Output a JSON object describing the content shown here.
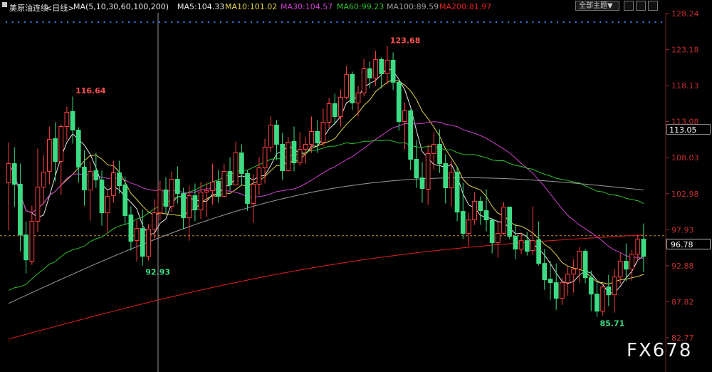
{
  "header": {
    "symbol": "美原油连续",
    "period": "<日线>",
    "ma_params": "MA(5,10,30,60,100,200)",
    "ma5": "MA5:104.33",
    "ma10": "MA10:101.02",
    "ma30": "MA30:104.57",
    "ma60": "MA60:99.23",
    "ma100": "MA100:89.59",
    "ma200": "MA200:81.97",
    "theme_select": "全部主题▼"
  },
  "colors": {
    "background": "#000000",
    "up": "#ff4040",
    "down": "#3ddc84",
    "ma5": "#e8e8e8",
    "ma10": "#e6d34a",
    "ma30": "#d040d0",
    "ma60": "#2fbf2f",
    "ma100": "#9a9a9a",
    "ma200": "#e02020",
    "axis_text": "#c03030",
    "price_line": "#d08a2a"
  },
  "price_axis": {
    "ticks": [
      "128.24",
      "123.18",
      "118.13",
      "113.08",
      "108.03",
      "102.98",
      "97.93",
      "92.88",
      "87.82",
      "82.77"
    ],
    "cursor_price": "113.05",
    "last_price": "96.78"
  },
  "chart_data": {
    "type": "candlestick",
    "ylim": [
      82.77,
      128.24
    ],
    "annotations": [
      {
        "label": "116.64",
        "value": 116.64
      },
      {
        "label": "92.93",
        "value": 92.93
      },
      {
        "label": "123.68",
        "value": 123.68
      },
      {
        "label": "85.71",
        "value": 85.71
      }
    ],
    "series_info": [
      {
        "name": "MA5",
        "value": 104.33
      },
      {
        "name": "MA10",
        "value": 101.02
      },
      {
        "name": "MA30",
        "value": 104.57
      },
      {
        "name": "MA60",
        "value": 99.23
      },
      {
        "name": "MA100",
        "value": 89.59
      },
      {
        "name": "MA200",
        "value": 81.97
      }
    ],
    "candles": [
      [
        104.5,
        110.2,
        97.8,
        107.2
      ],
      [
        107.2,
        109.5,
        101.1,
        104.3
      ],
      [
        104.3,
        107.2,
        94.9,
        97.2
      ],
      [
        97.2,
        99.1,
        91.8,
        93.7
      ],
      [
        93.5,
        101.3,
        93.0,
        99.1
      ],
      [
        99.1,
        109.3,
        97.6,
        103.9
      ],
      [
        103.9,
        108.4,
        101.5,
        106.0
      ],
      [
        106.1,
        112.4,
        104.3,
        110.6
      ],
      [
        110.7,
        113.0,
        104.7,
        107.5
      ],
      [
        107.5,
        112.7,
        102.8,
        112.4
      ],
      [
        112.4,
        115.2,
        110.5,
        114.4
      ],
      [
        114.5,
        116.6,
        110.0,
        111.9
      ],
      [
        111.9,
        112.3,
        104.5,
        106.7
      ],
      [
        106.7,
        109.1,
        101.3,
        103.5
      ],
      [
        103.5,
        107.4,
        99.2,
        106.1
      ],
      [
        106.2,
        108.7,
        103.8,
        104.9
      ],
      [
        104.9,
        106.2,
        98.5,
        100.3
      ],
      [
        100.3,
        103.5,
        97.4,
        102.6
      ],
      [
        102.7,
        107.6,
        101.7,
        105.9
      ],
      [
        105.9,
        107.6,
        103.0,
        104.1
      ],
      [
        104.2,
        105.4,
        98.6,
        99.9
      ],
      [
        100.0,
        101.2,
        95.0,
        96.3
      ],
      [
        96.4,
        99.3,
        93.5,
        98.1
      ],
      [
        98.1,
        100.7,
        92.9,
        94.2
      ],
      [
        94.2,
        98.7,
        93.6,
        98.0
      ],
      [
        98.0,
        102.2,
        96.7,
        100.3
      ],
      [
        100.3,
        104.8,
        99.2,
        103.5
      ],
      [
        103.5,
        105.3,
        100.2,
        101.2
      ],
      [
        101.2,
        106.1,
        100.4,
        105.0
      ],
      [
        105.0,
        106.8,
        101.6,
        103.0
      ],
      [
        103.0,
        103.8,
        98.0,
        99.6
      ],
      [
        99.6,
        104.1,
        96.4,
        102.7
      ],
      [
        102.7,
        104.4,
        99.1,
        100.7
      ],
      [
        100.7,
        104.6,
        99.4,
        103.2
      ],
      [
        103.2,
        104.6,
        99.7,
        103.4
      ],
      [
        103.4,
        107.2,
        101.4,
        104.6
      ],
      [
        104.7,
        106.3,
        101.7,
        102.6
      ],
      [
        102.6,
        107.2,
        102.5,
        106.1
      ],
      [
        106.1,
        108.1,
        103.4,
        104.2
      ],
      [
        104.2,
        110.3,
        104.2,
        108.7
      ],
      [
        108.7,
        109.9,
        104.2,
        105.8
      ],
      [
        105.8,
        106.3,
        100.6,
        101.6
      ],
      [
        101.6,
        105.7,
        98.9,
        104.3
      ],
      [
        104.3,
        108.1,
        102.8,
        106.6
      ],
      [
        106.6,
        110.7,
        104.4,
        109.5
      ],
      [
        109.5,
        113.9,
        108.8,
        112.6
      ],
      [
        112.6,
        113.3,
        107.7,
        109.9
      ],
      [
        109.9,
        111.5,
        104.9,
        106.2
      ],
      [
        106.2,
        110.9,
        106.1,
        110.2
      ],
      [
        110.3,
        112.4,
        106.1,
        107.3
      ],
      [
        107.3,
        111.6,
        106.9,
        109.2
      ],
      [
        109.2,
        110.9,
        107.2,
        109.9
      ],
      [
        109.9,
        113.8,
        108.7,
        111.7
      ],
      [
        111.7,
        113.3,
        108.7,
        110.1
      ],
      [
        110.2,
        114.9,
        109.6,
        113.0
      ],
      [
        113.0,
        116.4,
        112.2,
        115.6
      ],
      [
        115.6,
        117.0,
        112.6,
        113.8
      ],
      [
        113.8,
        117.6,
        112.4,
        116.5
      ],
      [
        116.5,
        120.9,
        116.2,
        119.7
      ],
      [
        119.7,
        120.1,
        114.7,
        115.7
      ],
      [
        115.7,
        118.1,
        113.8,
        117.1
      ],
      [
        117.1,
        121.9,
        116.6,
        120.5
      ],
      [
        120.5,
        121.5,
        117.8,
        119.2
      ],
      [
        119.2,
        123.0,
        118.1,
        121.8
      ],
      [
        121.8,
        122.1,
        117.7,
        119.8
      ],
      [
        119.8,
        123.7,
        118.3,
        121.7
      ],
      [
        121.7,
        122.8,
        117.5,
        118.6
      ],
      [
        118.6,
        119.0,
        111.8,
        113.1
      ],
      [
        113.1,
        115.8,
        109.2,
        114.6
      ],
      [
        114.6,
        114.8,
        106.3,
        107.8
      ],
      [
        107.8,
        110.5,
        103.8,
        105.2
      ],
      [
        105.2,
        107.4,
        101.7,
        103.7
      ],
      [
        103.6,
        109.8,
        101.4,
        108.6
      ],
      [
        108.6,
        111.6,
        106.3,
        109.9
      ],
      [
        109.9,
        112.0,
        105.9,
        107.2
      ],
      [
        107.2,
        108.5,
        101.6,
        103.8
      ],
      [
        103.8,
        107.6,
        101.2,
        106.0
      ],
      [
        106.0,
        106.8,
        99.1,
        100.4
      ],
      [
        100.5,
        104.5,
        96.6,
        97.4
      ],
      [
        97.4,
        100.3,
        95.6,
        99.3
      ],
      [
        99.3,
        103.2,
        98.6,
        101.9
      ],
      [
        101.9,
        102.6,
        98.6,
        100.6
      ],
      [
        100.6,
        103.6,
        97.7,
        99.3
      ],
      [
        99.3,
        99.4,
        94.6,
        96.1
      ],
      [
        96.1,
        99.0,
        94.0,
        97.4
      ],
      [
        97.4,
        101.8,
        97.2,
        101.1
      ],
      [
        101.1,
        101.1,
        96.6,
        97.0
      ],
      [
        97.0,
        98.8,
        93.8,
        95.2
      ],
      [
        95.2,
        97.5,
        94.5,
        96.4
      ],
      [
        96.4,
        97.6,
        94.3,
        94.9
      ],
      [
        95.0,
        101.2,
        94.4,
        96.4
      ],
      [
        96.5,
        99.1,
        92.9,
        93.2
      ],
      [
        93.2,
        95.2,
        89.5,
        90.9
      ],
      [
        91.0,
        93.5,
        88.1,
        90.5
      ],
      [
        90.5,
        93.2,
        86.7,
        88.3
      ],
      [
        88.3,
        91.2,
        87.4,
        90.5
      ],
      [
        90.5,
        92.8,
        88.7,
        91.7
      ],
      [
        91.7,
        93.8,
        89.1,
        92.4
      ],
      [
        92.4,
        95.5,
        90.5,
        94.9
      ],
      [
        94.9,
        95.2,
        90.4,
        91.2
      ],
      [
        91.2,
        92.2,
        86.5,
        88.9
      ],
      [
        88.9,
        90.6,
        85.7,
        86.5
      ],
      [
        86.5,
        90.1,
        85.9,
        89.9
      ],
      [
        89.9,
        91.6,
        87.2,
        88.8
      ],
      [
        88.8,
        92.4,
        86.3,
        91.3
      ],
      [
        91.3,
        94.6,
        90.3,
        93.5
      ],
      [
        93.5,
        96.0,
        90.7,
        92.4
      ],
      [
        92.4,
        95.1,
        90.8,
        94.5
      ],
      [
        94.5,
        97.2,
        93.5,
        96.6
      ],
      [
        96.6,
        98.8,
        92.0,
        94.2
      ]
    ]
  }
}
